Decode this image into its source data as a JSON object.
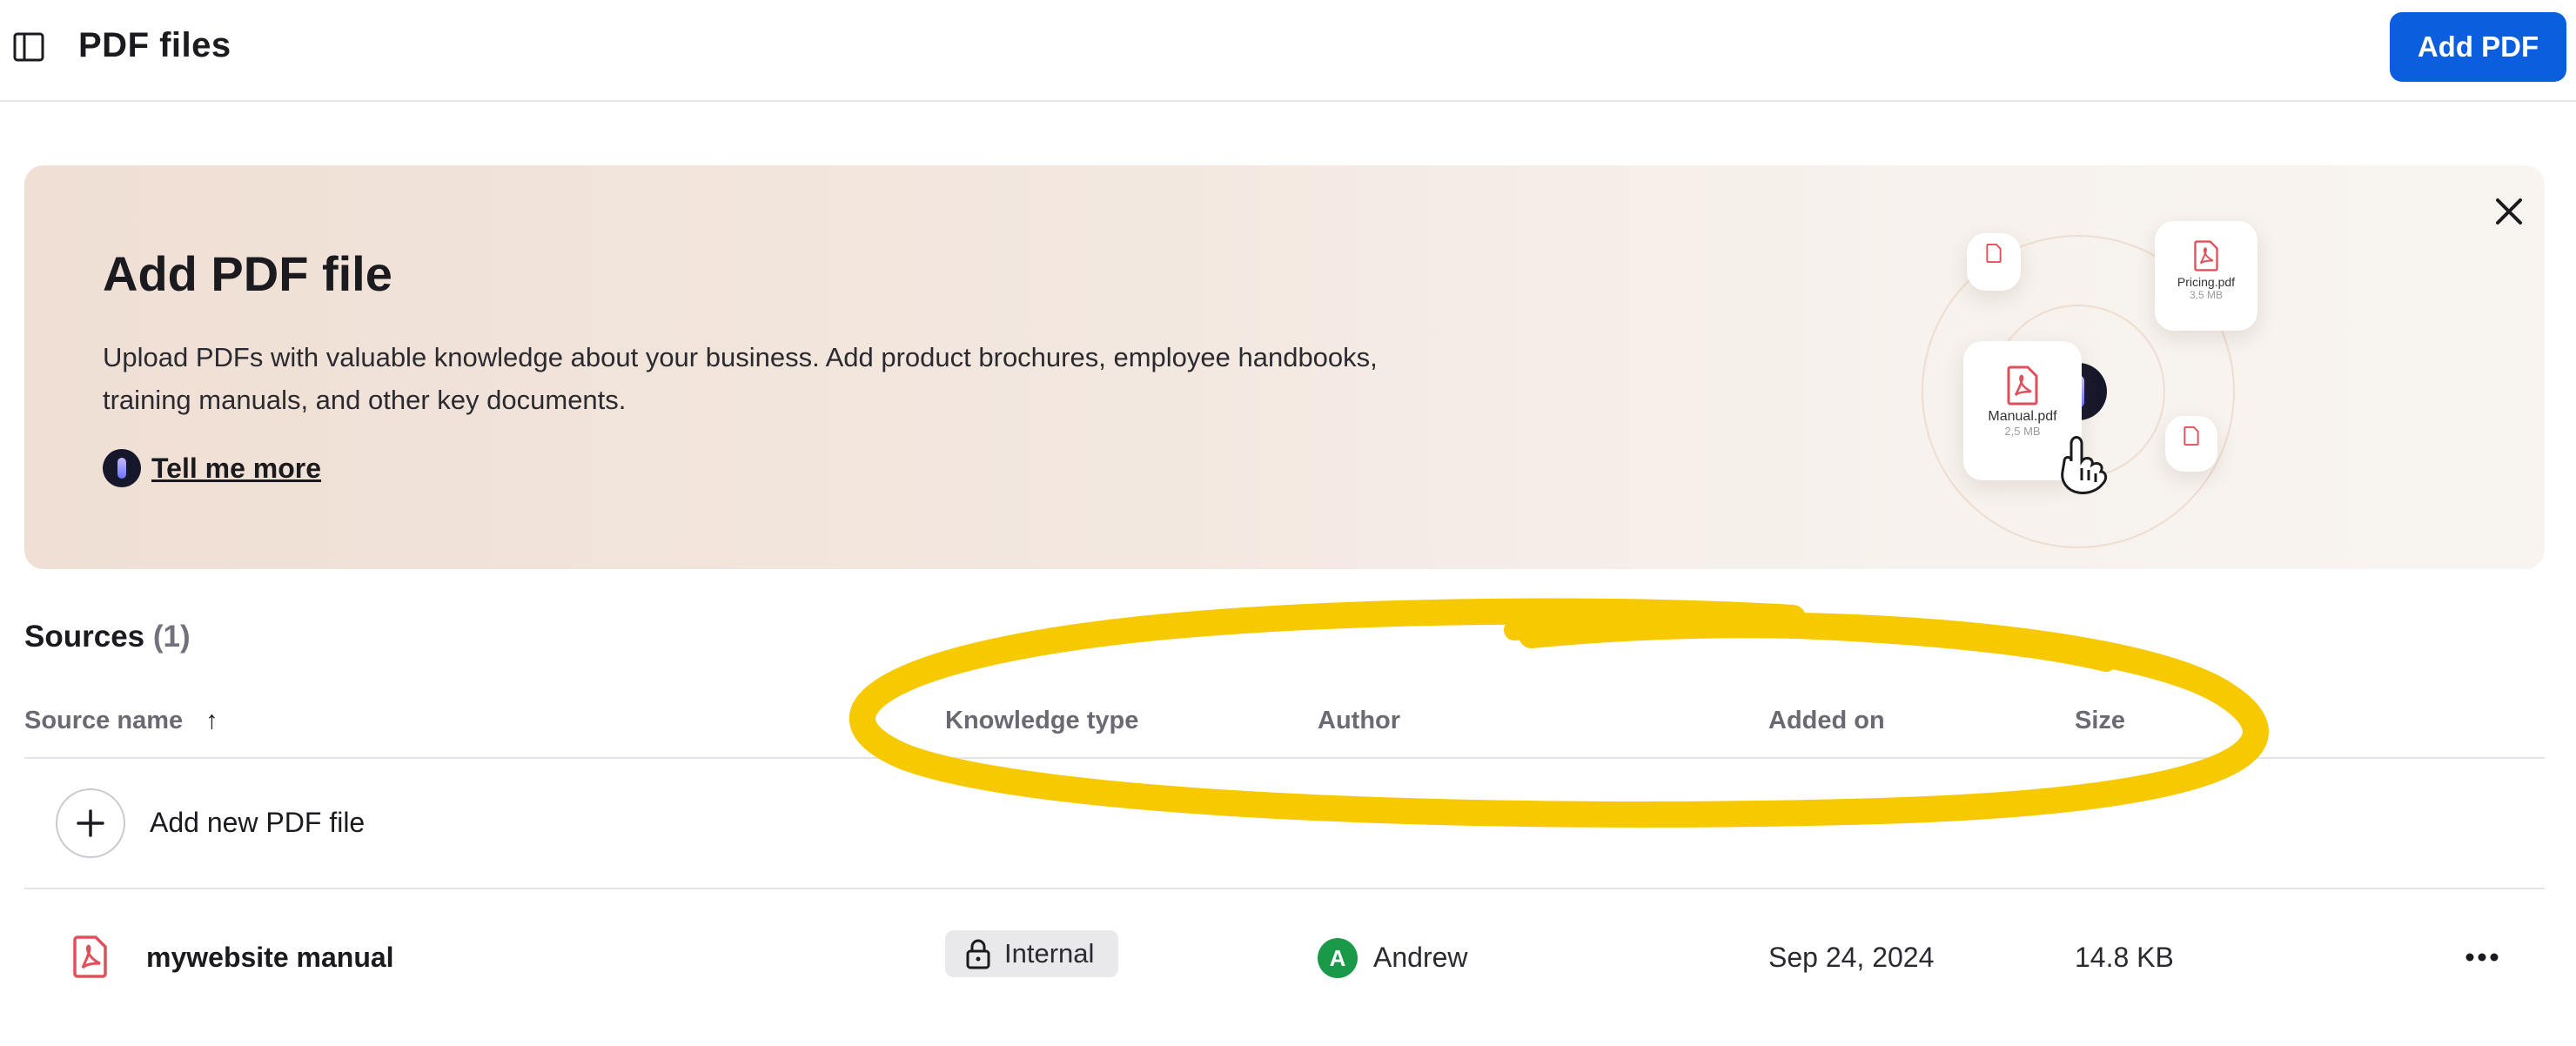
{
  "header": {
    "title": "PDF files",
    "add_button_label": "Add PDF"
  },
  "banner": {
    "title": "Add PDF file",
    "description": "Upload PDFs with valuable knowledge about your business. Add product brochures, employee handbooks, training manuals, and other key documents.",
    "tell_more_label": "Tell me more",
    "illustration": {
      "card_main": {
        "name": "Manual.pdf",
        "size": "2,5 MB"
      },
      "card_secondary": {
        "name": "Pricing.pdf",
        "size": "3,5 MB"
      }
    }
  },
  "sources": {
    "title": "Sources",
    "count": "(1)",
    "columns": {
      "source_name": "Source name",
      "sort_indicator": "↑",
      "knowledge_type": "Knowledge type",
      "author": "Author",
      "added_on": "Added on",
      "size": "Size"
    },
    "add_new_label": "Add new PDF file",
    "rows": [
      {
        "name": "mywebsite manual",
        "knowledge_type": "Internal",
        "author_initial": "A",
        "author": "Andrew",
        "added_on": "Sep 24, 2024",
        "size": "14.8 KB"
      }
    ]
  },
  "colors": {
    "primary": "#0b5fde",
    "highlight": "#f6c900",
    "avatar": "#1a9a48",
    "pdf_icon": "#e0505a"
  }
}
